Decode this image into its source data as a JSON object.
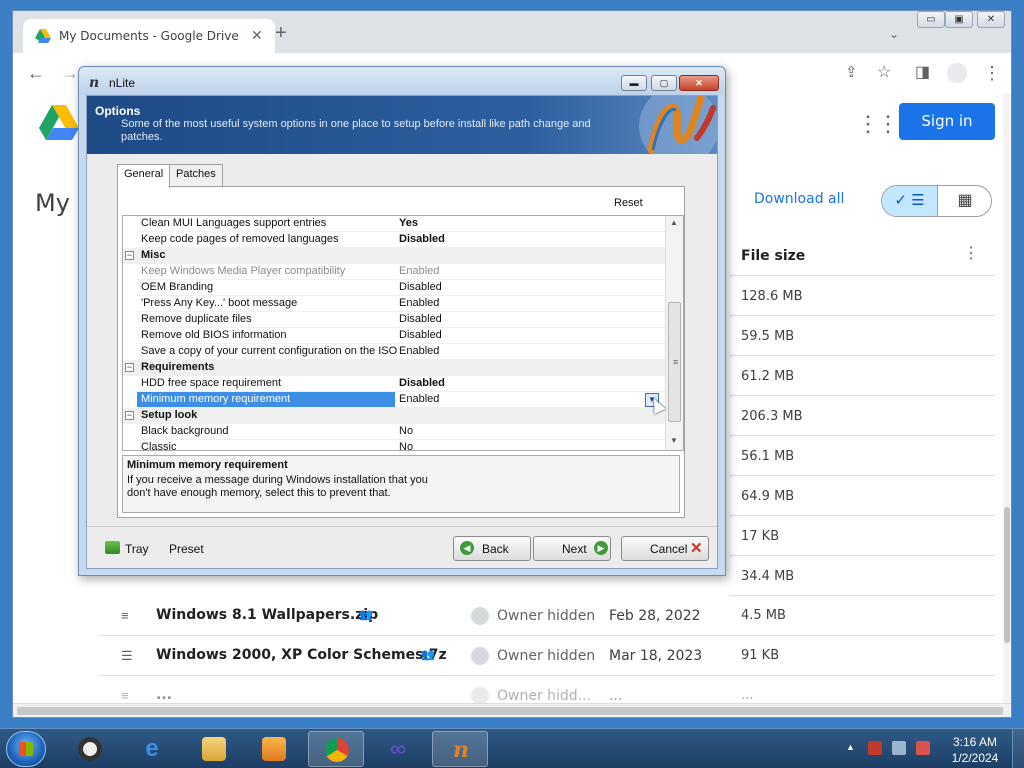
{
  "chrome": {
    "tab_title": "My Documents - Google Drive",
    "tab_close": "✕",
    "new_tab": "+",
    "tab_menu": "⌄",
    "win_min": "▭",
    "win_max": "▣",
    "win_close": "✕"
  },
  "drive": {
    "heading": "My D",
    "sign_in": "Sign in",
    "download_all": "Download all",
    "view_list": "✓ ☰",
    "view_grid": "▦",
    "file_size_header": "File size",
    "sizes": [
      "128.6 MB",
      "59.5 MB",
      "61.2 MB",
      "206.3 MB",
      "56.1 MB",
      "64.9 MB",
      "17 KB",
      "34.4 MB"
    ],
    "rows": [
      {
        "name": "Windows 8.1 Wallpapers.zip",
        "owner": "Owner hidden",
        "date": "Feb 28, 2022",
        "size": "4.5 MB",
        "icon": "≡"
      },
      {
        "name": "Windows 2000, XP Color Schemes.7z",
        "owner": "Owner hidden",
        "date": "Mar 18, 2023",
        "size": "91 KB",
        "icon": "☰"
      },
      {
        "name": "...",
        "owner": "Owner hidd...",
        "date": "...",
        "size": "...",
        "icon": "≡"
      }
    ]
  },
  "nlite": {
    "title": "nLite",
    "header_title": "Options",
    "header_desc": "Some of the most useful system options in one place to setup before install like path change and patches.",
    "tabs": [
      "General",
      "Patches"
    ],
    "reset": "Reset",
    "grid_rows": [
      {
        "kind": "prop",
        "name": "Clean MUI Languages support entries",
        "value": "Yes",
        "bold": true
      },
      {
        "kind": "prop",
        "name": "Keep code pages of removed languages",
        "value": "Disabled",
        "bold": true
      },
      {
        "kind": "cat",
        "name": "Misc"
      },
      {
        "kind": "prop",
        "name": "Keep Windows Media Player compatibility",
        "value": "Enabled",
        "muted": true
      },
      {
        "kind": "prop",
        "name": "OEM Branding",
        "value": "Disabled"
      },
      {
        "kind": "prop",
        "name": "'Press Any Key...' boot message",
        "value": "Enabled"
      },
      {
        "kind": "prop",
        "name": "Remove duplicate files",
        "value": "Disabled"
      },
      {
        "kind": "prop",
        "name": "Remove old BIOS information",
        "value": "Disabled"
      },
      {
        "kind": "prop",
        "name": "Save a copy of your current configuration on the ISO",
        "value": "Enabled"
      },
      {
        "kind": "cat",
        "name": "Requirements"
      },
      {
        "kind": "prop",
        "name": "HDD free space requirement",
        "value": "Disabled",
        "bold": true
      },
      {
        "kind": "prop",
        "name": "Minimum memory requirement",
        "value": "Enabled",
        "selected": true
      },
      {
        "kind": "cat",
        "name": "Setup look"
      },
      {
        "kind": "prop",
        "name": "Black background",
        "value": "No"
      },
      {
        "kind": "prop",
        "name": "Classic",
        "value": "No"
      }
    ],
    "desc_title": "Minimum memory requirement",
    "desc_text": "If you receive a message during Windows installation that you don't have enough memory, select this to prevent that.",
    "tray": "Tray",
    "preset": "Preset",
    "back": "Back",
    "next": "Next",
    "cancel": "Cancel"
  },
  "taskbar": {
    "time": "3:16 AM",
    "date": "1/2/2024"
  },
  "colors": {
    "accent": "#1a73e8",
    "selection": "#3d8ee6",
    "nlite_header": "#1e4a86"
  }
}
